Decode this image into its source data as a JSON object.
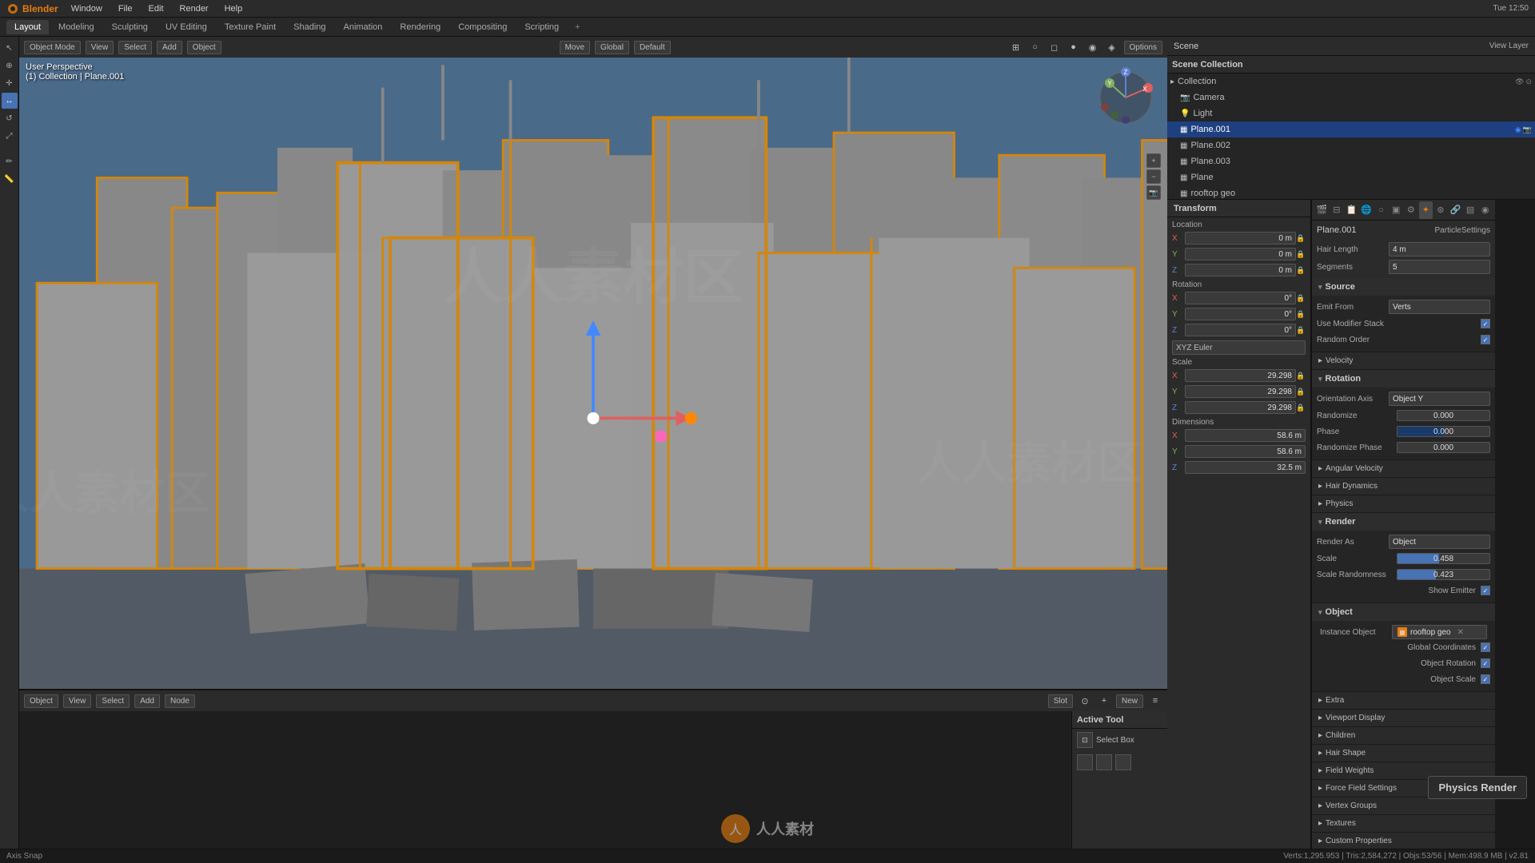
{
  "app": {
    "name": "Blender",
    "version": "2.81",
    "time": "Tue 12:50"
  },
  "top_menu": {
    "items": [
      "Blender",
      "Window",
      "File",
      "Edit",
      "Render",
      "Window",
      "Help"
    ]
  },
  "workspace_tabs": {
    "items": [
      "Layout",
      "Modeling",
      "Sculpting",
      "UV Editing",
      "Texture Paint",
      "Shading",
      "Animation",
      "Rendering",
      "Compositing",
      "Scripting"
    ],
    "active": "Layout"
  },
  "viewport": {
    "mode": "Object Mode",
    "view_label": "User Perspective",
    "collection_info": "(1) Collection | Plane.001",
    "orientation": "Global",
    "pivot": "Default",
    "drag_action": "Move",
    "options_label": "Options"
  },
  "node_editor": {
    "mode": "Object",
    "slot": "Slot",
    "new_label": "New"
  },
  "transform": {
    "header": "Transform",
    "location_label": "Location",
    "loc_x": "0 m",
    "loc_y": "0 m",
    "loc_z": "0 m",
    "rotation_label": "Rotation",
    "rot_x": "0°",
    "rot_y": "0°",
    "rot_z": "0°",
    "xyz_euler": "XYZ Euler",
    "scale_label": "Scale",
    "scale_x": "29.298",
    "scale_y": "29.298",
    "scale_z": "29.298",
    "dimensions_label": "Dimensions",
    "dim_x": "58.6 m",
    "dim_y": "58.6 m",
    "dim_z": "32.5 m"
  },
  "scene": {
    "name": "Scene",
    "view_layer": "View Layer"
  },
  "outliner": {
    "header": "Scene Collection",
    "items": [
      {
        "name": "Collection",
        "indent": 0,
        "icon": "▸",
        "type": "collection"
      },
      {
        "name": "Camera",
        "indent": 1,
        "icon": "📷",
        "type": "camera"
      },
      {
        "name": "Light",
        "indent": 1,
        "icon": "💡",
        "type": "light"
      },
      {
        "name": "Plane.001",
        "indent": 1,
        "icon": "▦",
        "type": "mesh",
        "selected": true
      },
      {
        "name": "Plane.002",
        "indent": 1,
        "icon": "▦",
        "type": "mesh"
      },
      {
        "name": "Plane.003",
        "indent": 1,
        "icon": "▦",
        "type": "mesh"
      },
      {
        "name": "Plane",
        "indent": 1,
        "icon": "▦",
        "type": "mesh"
      },
      {
        "name": "rooftop geo",
        "indent": 1,
        "icon": "▦",
        "type": "mesh"
      }
    ]
  },
  "properties": {
    "particle_settings": "ParticleSettings",
    "plane_name": "Plane.001",
    "hair_length_label": "Hair Length",
    "hair_length_value": "4 m",
    "segments_label": "Segments",
    "segments_value": "5",
    "source": {
      "header": "Source",
      "emit_from_label": "Emit From",
      "emit_from_value": "Verts",
      "use_modifier_stack": "Use Modifier Stack",
      "random_order": "Random Order"
    },
    "hair_dynamics": {
      "header": "Hair Dynamics"
    },
    "physics_header": "Physics",
    "render_header": "Render",
    "render_as_label": "Render As",
    "render_as_value": "Object",
    "scale_label": "Scale",
    "scale_value": "0.458",
    "scale_randomness_label": "Scale Randomness",
    "scale_randomness_value": "0.423",
    "show_emitter_label": "Show Emitter",
    "object_header": "Object",
    "instance_object_label": "Instance Object",
    "instance_object_value": "rooftop geo",
    "global_coordinates": "Global Coordinates",
    "object_rotation": "Object Rotation",
    "object_scale": "Object Scale",
    "extra": "Extra",
    "viewport_display": "Viewport Display",
    "children": "Children",
    "hair_shape": "Hair Shape",
    "field_weights": "Field Weights",
    "force_field_settings": "Force Field Settings",
    "vertex_groups": "Vertex Groups",
    "textures": "Textures",
    "custom_properties": "Custom Properties"
  },
  "velocity": {
    "header": "Velocity"
  },
  "rotation_section": {
    "header": "Rotation",
    "orientation_axis_label": "Orientation Axis",
    "orientation_axis_value": "Object Y",
    "randomize_label": "Randomize",
    "randomize_value": "0.000",
    "phase_label": "Phase",
    "phase_value": "0.000",
    "randomize_phase_label": "Randomize Phase",
    "randomize_phase_value": "0.000"
  },
  "angular_velocity": {
    "header": "Angular Velocity"
  },
  "active_tool": {
    "header": "Active Tool",
    "select_box": "Select Box"
  },
  "status_bar": {
    "axis_snap": "Axis Snap",
    "verts_info": "Verts:1,295.953 | Tris:2,584,272 | Objs:53/56 | Mem:498.9 MB | v2.81"
  },
  "physics_render": "Physics Render"
}
